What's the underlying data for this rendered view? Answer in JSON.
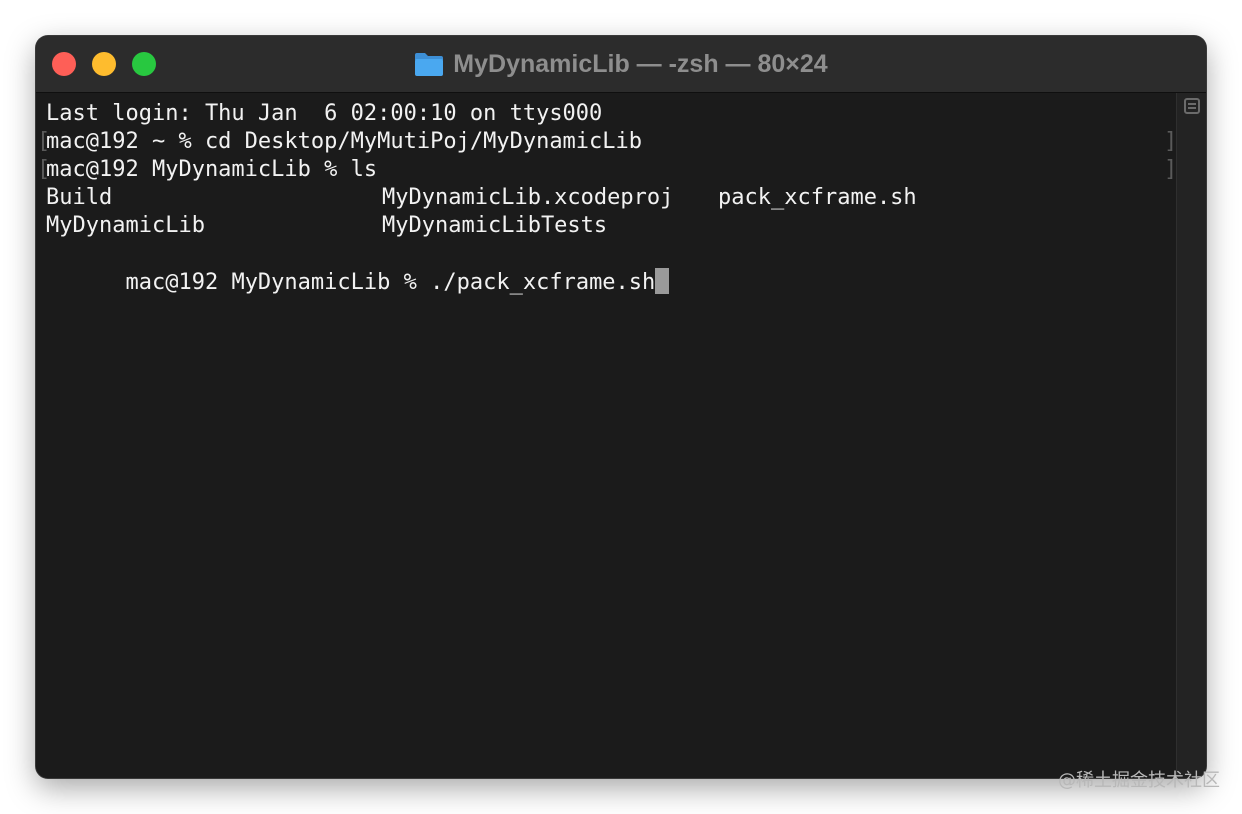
{
  "window": {
    "title": "MyDynamicLib — -zsh — 80×24",
    "folder_icon": "folder-icon",
    "traffic_lights": {
      "close_color": "#fe5f57",
      "minimize_color": "#febc2e",
      "maximize_color": "#28c840"
    }
  },
  "terminal": {
    "background": "#1b1b1b",
    "text_color": "#f2f2f2",
    "lines": [
      {
        "text": "Last login: Thu Jan  6 02:00:10 on ttys000"
      },
      {
        "text": "mac@192 ~ % cd Desktop/MyMutiPoj/MyDynamicLib"
      },
      {
        "text": "mac@192 MyDynamicLib % ls"
      },
      {
        "text": "mac@192 MyDynamicLib % ./pack_xcframe.sh"
      }
    ],
    "ls_output": [
      [
        "Build",
        "MyDynamicLib.xcodeproj",
        "pack_xcframe.sh"
      ],
      [
        "MyDynamicLib",
        "MyDynamicLibTests"
      ]
    ],
    "mark_left": "[",
    "mark_right": "]"
  },
  "watermark": "@稀土掘金技术社区"
}
